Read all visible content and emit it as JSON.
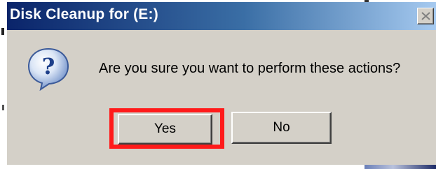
{
  "window": {
    "title": "Disk Cleanup for  (E:)",
    "close_icon": "close-icon"
  },
  "dialog": {
    "icon": "question-icon",
    "message": "Are you sure you want to perform these actions?"
  },
  "buttons": {
    "yes_label": "Yes",
    "no_label": "No"
  },
  "colors": {
    "titlebar_start": "#0a246a",
    "titlebar_end": "#a6caf0",
    "dialog_bg": "#d4d0c8",
    "highlight": "#ff1a1a"
  }
}
